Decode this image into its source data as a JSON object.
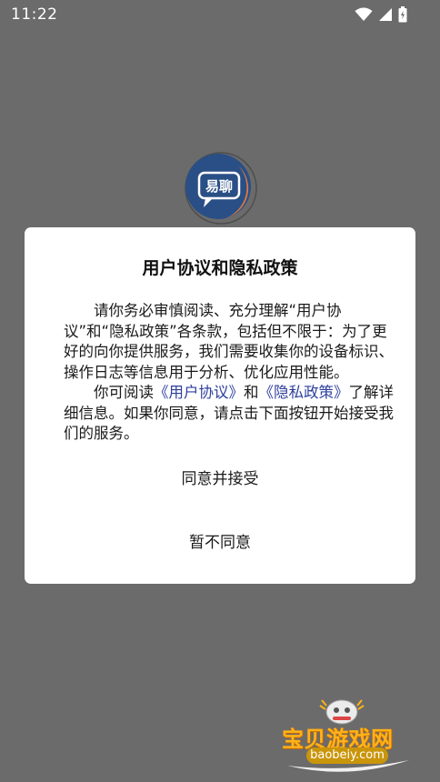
{
  "status_bar": {
    "time": "11:22",
    "icons": [
      "wifi-icon",
      "signal-icon",
      "battery-icon"
    ]
  },
  "app": {
    "logo_text": "易聊"
  },
  "dialog": {
    "title": "用户协议和隐私政策",
    "para1": "请你务必审慎阅读、充分理解“用户协议”和“隐私政策”各条款，包括但不限于：为了更好的向你提供服务，我们需要收集你的设备标识、操作日志等信息用于分析、优化应用性能。",
    "para2_prefix": "你可阅读",
    "user_agreement_link": "《用户协议》",
    "para2_and": "和",
    "privacy_policy_link": "《隐私政策》",
    "para2_suffix": "了解详细信息。如果你同意，请点击下面按钮开始接受我们的服务。",
    "agree_button": "同意并接受",
    "disagree_button": "暂不同意"
  },
  "watermark": {
    "text": "宝贝游戏网",
    "url": "baobeiy.com"
  },
  "colors": {
    "overlay": "#6b6b6b",
    "link": "#2e3f9e",
    "logo_blue": "#2a4f86",
    "logo_orange": "#e07a3a",
    "watermark_gold": "#ffb21a"
  }
}
